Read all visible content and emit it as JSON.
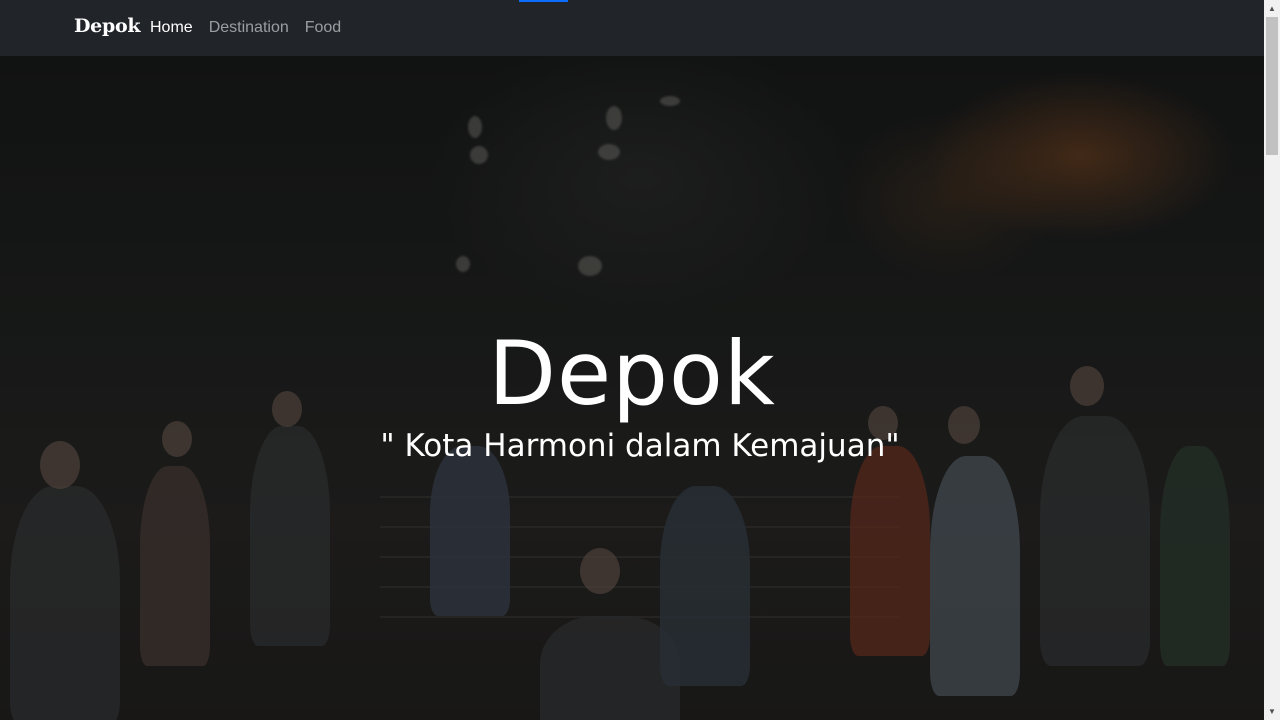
{
  "navbar": {
    "brand": "Depok",
    "links": [
      {
        "label": "Home",
        "active": true
      },
      {
        "label": "Destination",
        "active": false
      },
      {
        "label": "Food",
        "active": false
      }
    ],
    "background": "#212529"
  },
  "hero": {
    "title": "Depok",
    "tagline": "\" Kota Harmoni dalam Kemajuan\""
  },
  "scrollbar": {
    "up_arrow": "▲",
    "down_arrow": "▼"
  }
}
